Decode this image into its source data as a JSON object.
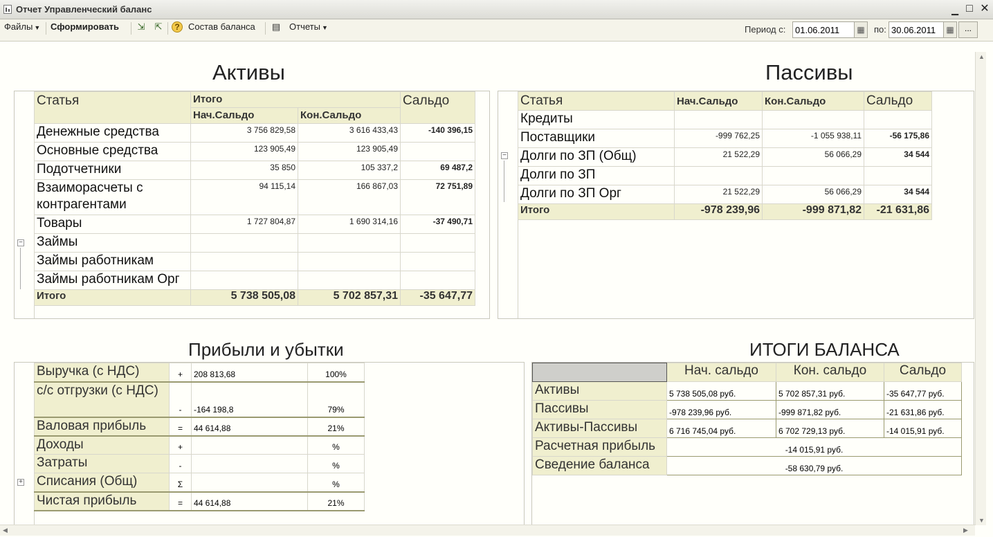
{
  "window": {
    "title": "Отчет  Управленческий баланс"
  },
  "toolbar": {
    "files": "Файлы",
    "generate": "Сформировать",
    "composition": "Состав баланса",
    "reports": "Отчеты",
    "period_from_label": "Период с:",
    "period_from": "01.06.2011",
    "period_to_label": "по:",
    "period_to": "30.06.2011",
    "dots": "..."
  },
  "assets": {
    "title": "Активы",
    "headers": {
      "item": "Статья",
      "total": "Итого",
      "start": "Нач.Сальдо",
      "end": "Кон.Сальдо",
      "balance": "Сальдо"
    },
    "rows": [
      {
        "name": "Денежные средства",
        "start": "3 756 829,58",
        "end": "3 616 433,43",
        "balance": "-140 396,15"
      },
      {
        "name": "Основные средства",
        "start": "123 905,49",
        "end": "123 905,49",
        "balance": ""
      },
      {
        "name": "Подотчетники",
        "start": "35 850",
        "end": "105 337,2",
        "balance": "69 487,2"
      },
      {
        "name": "Взаиморасчеты с контрагентами",
        "start": "94 115,14",
        "end": "166 867,03",
        "balance": "72 751,89"
      },
      {
        "name": "Товары",
        "start": "1 727 804,87",
        "end": "1 690 314,16",
        "balance": "-37 490,71"
      },
      {
        "name": "Займы",
        "start": "",
        "end": "",
        "balance": ""
      },
      {
        "name": "Займы работникам",
        "start": "",
        "end": "",
        "balance": ""
      },
      {
        "name": "Займы работникам Орг",
        "start": "",
        "end": "",
        "balance": ""
      }
    ],
    "total": {
      "label": "Итого",
      "start": "5 738 505,08",
      "end": "5 702 857,31",
      "balance": "-35 647,77"
    }
  },
  "liabilities": {
    "title": "Пассивы",
    "headers": {
      "item": "Статья",
      "start": "Нач.Сальдо",
      "end": "Кон.Сальдо",
      "balance": "Сальдо"
    },
    "rows": [
      {
        "name": "Кредиты",
        "start": "",
        "end": "",
        "balance": ""
      },
      {
        "name": "Поставщики",
        "start": "-999 762,25",
        "end": "-1 055 938,11",
        "balance": "-56 175,86"
      },
      {
        "name": "Долги по ЗП (Общ)",
        "start": "21 522,29",
        "end": "56 066,29",
        "balance": "34 544"
      },
      {
        "name": "Долги по ЗП",
        "start": "",
        "end": "",
        "balance": ""
      },
      {
        "name": "Долги по ЗП Орг",
        "start": "21 522,29",
        "end": "56 066,29",
        "balance": "34 544"
      }
    ],
    "total": {
      "label": "Итого",
      "start": "-978 239,96",
      "end": "-999 871,82",
      "balance": "-21 631,86"
    }
  },
  "profit": {
    "title": "Прибыли и убытки",
    "rows": [
      {
        "name": "Выручка (с НДС)",
        "sign": "+",
        "value": "208 813,68",
        "pct": "100%"
      },
      {
        "name": "с/с отгрузки (с НДС)",
        "sign": "-",
        "value": "-164 198,8",
        "pct": "79%"
      },
      {
        "name": "Валовая прибыль",
        "sign": "=",
        "value": "44 614,88",
        "pct": "21%"
      },
      {
        "name": "Доходы",
        "sign": "+",
        "value": "",
        "pct": "%"
      },
      {
        "name": "Затраты",
        "sign": "-",
        "value": "",
        "pct": "%"
      },
      {
        "name": "Списания (Общ)",
        "sign": "Σ",
        "value": "",
        "pct": "%"
      },
      {
        "name": "Чистая прибыль",
        "sign": "=",
        "value": "44 614,88",
        "pct": "21%"
      }
    ]
  },
  "totals": {
    "title": "ИТОГИ БАЛАНСА",
    "headers": {
      "start": "Нач. сальдо",
      "end": "Кон. сальдо",
      "balance": "Сальдо"
    },
    "rows": [
      {
        "name": "Активы",
        "start": "5 738 505,08 руб.",
        "end": "5 702 857,31 руб.",
        "balance": "-35 647,77 руб."
      },
      {
        "name": "Пассивы",
        "start": "-978 239,96 руб.",
        "end": "-999 871,82 руб.",
        "balance": "-21 631,86 руб."
      },
      {
        "name": "Активы-Пассивы",
        "start": "6 716 745,04 руб.",
        "end": "6 702 729,13 руб.",
        "balance": "-14 015,91 руб."
      }
    ],
    "calc_profit": {
      "name": "Расчетная прибыль",
      "value": "-14 015,91 руб."
    },
    "reconciliation": {
      "name": "Сведение баланса",
      "value": "-58 630,79 руб."
    }
  }
}
